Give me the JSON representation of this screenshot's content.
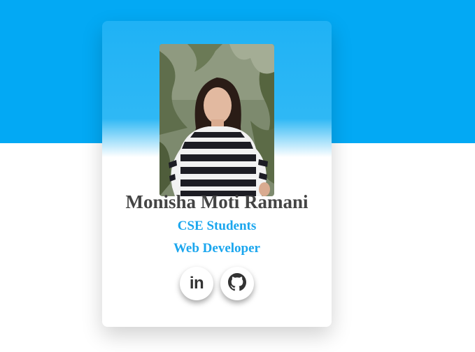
{
  "profile": {
    "name": "Monisha Moti Ramani",
    "role_primary": "CSE Students",
    "role_secondary": "Web Developer",
    "photo_alt": "Monisha Moti Ramani"
  },
  "socials": {
    "linkedin_label": "in",
    "linkedin_icon": "linkedin-icon",
    "github_icon": "github-icon"
  },
  "colors": {
    "banner": "#03a9f4",
    "accent_text": "#1aa6ee",
    "name_text": "#444444"
  }
}
